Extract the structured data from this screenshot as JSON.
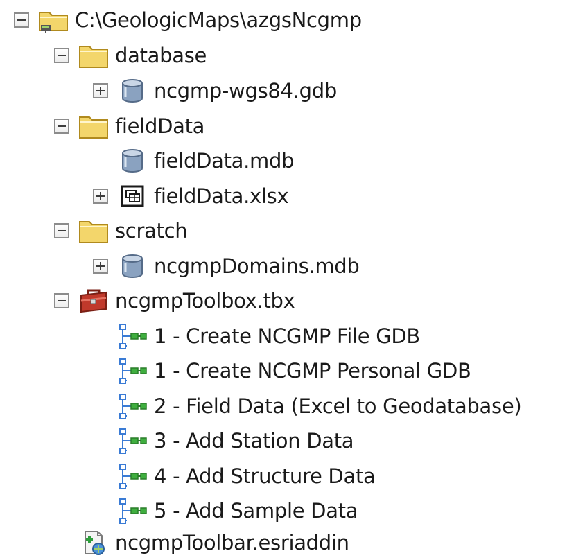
{
  "tree": {
    "root": {
      "label": "C:\\GeologicMaps\\azgsNcgmp",
      "icon": "folder-connection-icon",
      "state": "expanded"
    },
    "items": [
      {
        "label": "database",
        "icon": "folder-icon",
        "state": "expanded"
      },
      {
        "label": "ncgmp-wgs84.gdb",
        "icon": "geodatabase-icon",
        "state": "collapsed"
      },
      {
        "label": "fieldData",
        "icon": "folder-icon",
        "state": "expanded"
      },
      {
        "label": "fieldData.mdb",
        "icon": "geodatabase-icon",
        "state": "leaf"
      },
      {
        "label": "fieldData.xlsx",
        "icon": "excel-workbook-icon",
        "state": "collapsed"
      },
      {
        "label": "scratch",
        "icon": "folder-icon",
        "state": "expanded"
      },
      {
        "label": "ncgmpDomains.mdb",
        "icon": "geodatabase-icon",
        "state": "collapsed"
      },
      {
        "label": "ncgmpToolbox.tbx",
        "icon": "toolbox-icon",
        "state": "expanded"
      },
      {
        "label": "1 - Create NCGMP File GDB",
        "icon": "model-tool-icon",
        "state": "leaf"
      },
      {
        "label": "1 - Create NCGMP Personal GDB",
        "icon": "model-tool-icon",
        "state": "leaf"
      },
      {
        "label": "2 - Field Data (Excel to Geodatabase)",
        "icon": "model-tool-icon",
        "state": "leaf"
      },
      {
        "label": "3 - Add Station Data",
        "icon": "model-tool-icon",
        "state": "leaf"
      },
      {
        "label": "4 - Add Structure Data",
        "icon": "model-tool-icon",
        "state": "leaf"
      },
      {
        "label": "5 - Add Sample Data",
        "icon": "model-tool-icon",
        "state": "leaf"
      },
      {
        "label": "ncgmpToolbar.esriaddin",
        "icon": "addin-file-icon",
        "state": "leaf"
      }
    ]
  },
  "colors": {
    "folder": "#f3d66b",
    "folder_border": "#b08a1e",
    "database": "#8aa2c0",
    "toolbox": "#c0392b",
    "tool_connector": "#3a7bd5",
    "tool_node": "#3fae3f",
    "expander_border": "#8c8c8c"
  }
}
